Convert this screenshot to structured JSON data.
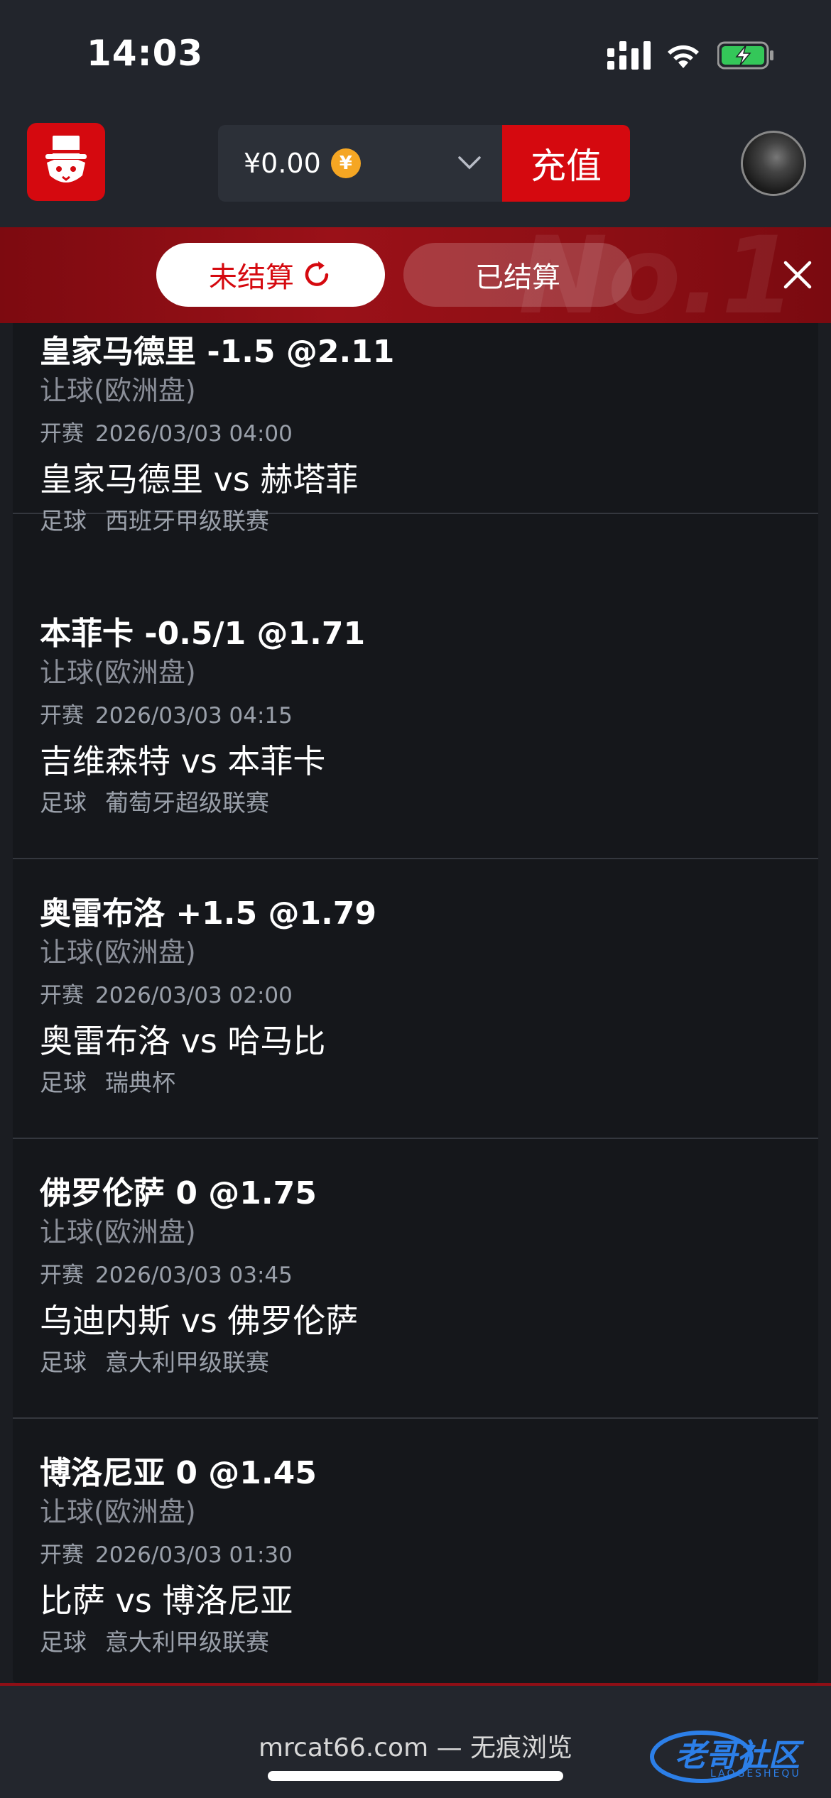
{
  "status_bar": {
    "time": "14:03"
  },
  "header": {
    "balance": "¥0.00",
    "coin_symbol": "¥",
    "recharge_label": "充值"
  },
  "tabs": {
    "unsettled_label": "未结算",
    "settled_label": "已结算",
    "banner_watermark": "No.1"
  },
  "bets": [
    {
      "title": "皇家马德里 -1.5 @2.11",
      "market": "让球(欧洲盘)",
      "kickoff_label": "开赛",
      "kickoff_time": "2026/03/03 04:00",
      "match": "皇家马德里 vs 赫塔菲",
      "sport": "足球",
      "league": "西班牙甲级联赛"
    },
    {
      "title": "本菲卡 -0.5/1 @1.71",
      "market": "让球(欧洲盘)",
      "kickoff_label": "开赛",
      "kickoff_time": "2026/03/03 04:15",
      "match": "吉维森特 vs 本菲卡",
      "sport": "足球",
      "league": "葡萄牙超级联赛"
    },
    {
      "title": "奥雷布洛 +1.5 @1.79",
      "market": "让球(欧洲盘)",
      "kickoff_label": "开赛",
      "kickoff_time": "2026/03/03 02:00",
      "match": "奥雷布洛 vs 哈马比",
      "sport": "足球",
      "league": "瑞典杯"
    },
    {
      "title": "佛罗伦萨 0 @1.75",
      "market": "让球(欧洲盘)",
      "kickoff_label": "开赛",
      "kickoff_time": "2026/03/03 03:45",
      "match": "乌迪内斯 vs 佛罗伦萨",
      "sport": "足球",
      "league": "意大利甲级联赛"
    },
    {
      "title": "博洛尼亚 0 @1.45",
      "market": "让球(欧洲盘)",
      "kickoff_label": "开赛",
      "kickoff_time": "2026/03/03 01:30",
      "match": "比萨 vs 博洛尼亚",
      "sport": "足球",
      "league": "意大利甲级联赛"
    }
  ],
  "bottom": {
    "url": "mrcat66.com — 无痕浏览",
    "watermark": "老哥社区",
    "watermark_sub": "LAOGESHEQU"
  },
  "colors": {
    "accent_red": "#d5090f",
    "banner_red": "#9a1118",
    "background": "#15171b",
    "coin_orange": "#f5a623"
  }
}
